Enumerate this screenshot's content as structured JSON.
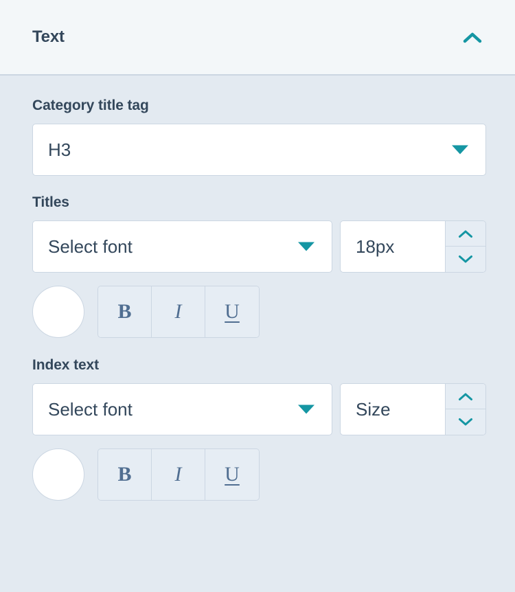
{
  "header": {
    "title": "Text",
    "collapse_icon": "chevron-up-icon"
  },
  "colors": {
    "accent_teal": "#1596a3",
    "text_dark": "#33475b",
    "panel_bg": "#e3eaf1",
    "header_bg": "#f3f7f9",
    "border": "#cbd6e2",
    "control_bg": "#e6edf4",
    "glyph": "#506e91",
    "swatch_fill": "#ffffff"
  },
  "fields": {
    "category_title_tag": {
      "label": "Category title tag",
      "value": "H3",
      "caret_icon": "caret-down-icon"
    },
    "titles": {
      "label": "Titles",
      "font": {
        "value": "Select font",
        "caret_icon": "caret-down-icon"
      },
      "size": {
        "value": "18px",
        "placeholder": "Size",
        "increment_icon": "chevron-up-icon",
        "decrement_icon": "chevron-down-icon"
      },
      "color_swatch": {
        "name": "text-color-swatch",
        "value": "#ffffff"
      },
      "format": {
        "bold": "B",
        "italic": "I",
        "underline": "U"
      }
    },
    "index_text": {
      "label": "Index text",
      "font": {
        "value": "Select font",
        "caret_icon": "caret-down-icon"
      },
      "size": {
        "value": "",
        "placeholder": "Size",
        "increment_icon": "chevron-up-icon",
        "decrement_icon": "chevron-down-icon"
      },
      "color_swatch": {
        "name": "text-color-swatch",
        "value": "#ffffff"
      },
      "format": {
        "bold": "B",
        "italic": "I",
        "underline": "U"
      }
    }
  }
}
